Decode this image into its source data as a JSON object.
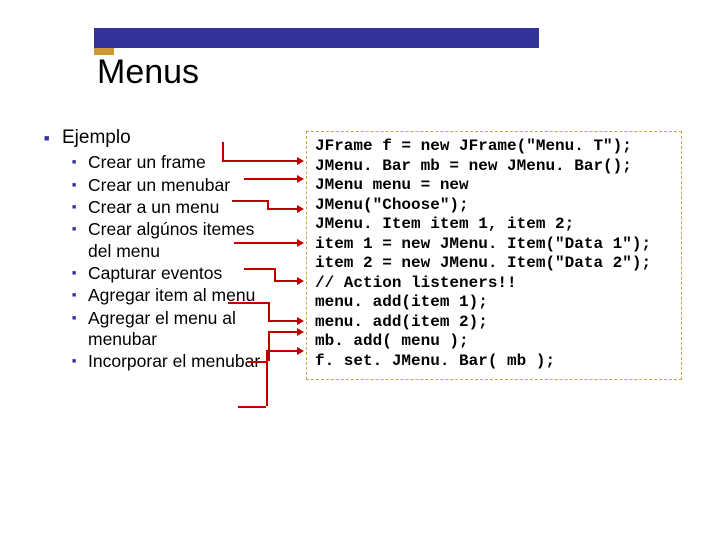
{
  "title": "Menus",
  "ejemplo_label": "Ejemplo",
  "steps": [
    "Crear un frame",
    "Crear un menubar",
    "Crear a un menu",
    "Crear algúnos itemes del menu",
    "Capturar eventos",
    "Agregar item al menu",
    "Agregar el menu al menubar",
    "Incorporar el menubar"
  ],
  "code": [
    "JFrame f = new JFrame(\"Menu. T\");",
    "JMenu. Bar mb = new JMenu. Bar();",
    "JMenu menu = new",
    "JMenu(\"Choose\");",
    "JMenu. Item item 1, item 2;",
    "item 1 = new JMenu. Item(\"Data 1\");",
    "item 2 = new JMenu. Item(\"Data 2\");",
    "// Action listeners!!",
    "menu. add(item 1);",
    "menu. add(item 2);",
    "mb. add( menu );",
    "f. set. JMenu. Bar( mb );"
  ]
}
